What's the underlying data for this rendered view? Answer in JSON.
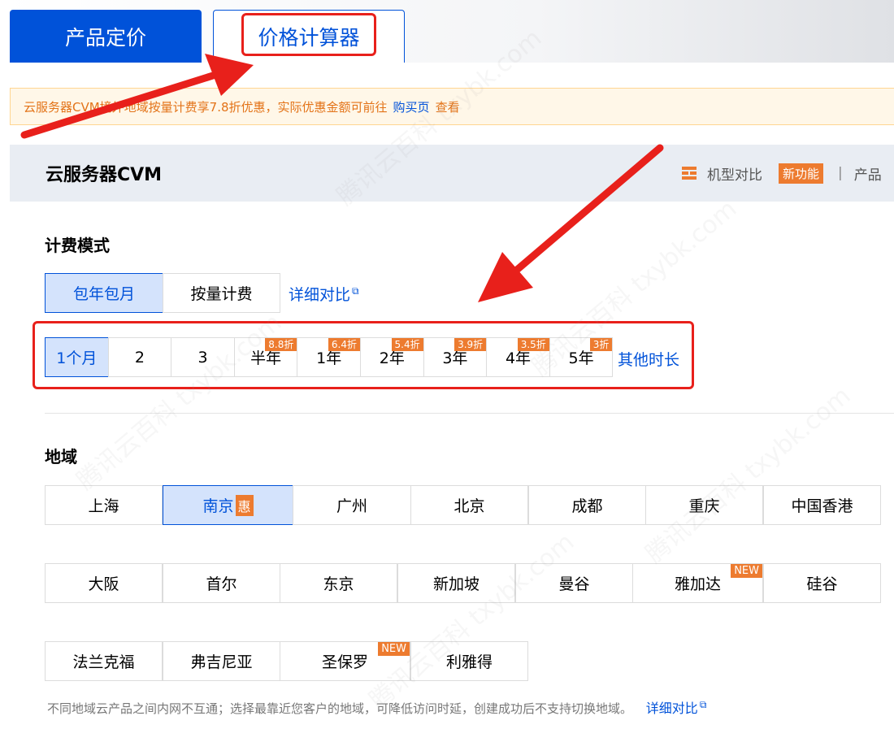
{
  "tabs": [
    {
      "label": "产品定价"
    },
    {
      "label": "价格计算器"
    }
  ],
  "notice": {
    "text": "云服务器CVM境外地域按量计费享7.8折优惠，实际优惠金额可前往",
    "link_label": "购买页",
    "suffix": "查看"
  },
  "header": {
    "title": "云服务器CVM",
    "compare_label": "机型对比",
    "new_badge": "新功能",
    "separator": "|",
    "truncated_label": "产品"
  },
  "billing": {
    "title": "计费模式",
    "options": [
      {
        "label": "包年包月",
        "selected": true
      },
      {
        "label": "按量计费",
        "selected": false
      }
    ],
    "detail_link": "详细对比"
  },
  "durations": {
    "options": [
      {
        "label": "1个月",
        "discount": "",
        "selected": true
      },
      {
        "label": "2",
        "discount": "",
        "selected": false
      },
      {
        "label": "3",
        "discount": "",
        "selected": false
      },
      {
        "label": "半年",
        "discount": "8.8折",
        "selected": false
      },
      {
        "label": "1年",
        "discount": "6.4折",
        "selected": false
      },
      {
        "label": "2年",
        "discount": "5.4折",
        "selected": false
      },
      {
        "label": "3年",
        "discount": "3.9折",
        "selected": false
      },
      {
        "label": "4年",
        "discount": "3.5折",
        "selected": false
      },
      {
        "label": "5年",
        "discount": "3折",
        "selected": false
      }
    ],
    "other_link": "其他时长"
  },
  "region": {
    "title": "地域",
    "rows": [
      [
        {
          "label": "上海",
          "tag": "",
          "selected": false
        },
        {
          "label": "南京",
          "tag": "惠",
          "selected": true
        },
        {
          "label": "广州",
          "tag": "",
          "selected": false
        },
        {
          "label": "北京",
          "tag": "",
          "selected": false
        },
        {
          "label": "成都",
          "tag": "",
          "selected": false
        },
        {
          "label": "重庆",
          "tag": "",
          "selected": false
        },
        {
          "label": "中国香港",
          "tag": "",
          "selected": false
        }
      ],
      [
        {
          "label": "大阪",
          "tag": "",
          "selected": false
        },
        {
          "label": "首尔",
          "tag": "",
          "selected": false
        },
        {
          "label": "东京",
          "tag": "",
          "selected": false
        },
        {
          "label": "新加坡",
          "tag": "",
          "selected": false
        },
        {
          "label": "曼谷",
          "tag": "",
          "selected": false
        },
        {
          "label": "雅加达",
          "tag": "NEW",
          "selected": false
        },
        {
          "label": "硅谷",
          "tag": "",
          "selected": false
        }
      ],
      [
        {
          "label": "法兰克福",
          "tag": "",
          "selected": false
        },
        {
          "label": "弗吉尼亚",
          "tag": "",
          "selected": false
        },
        {
          "label": "圣保罗",
          "tag": "NEW",
          "selected": false
        },
        {
          "label": "利雅得",
          "tag": "",
          "selected": false
        }
      ]
    ],
    "footnote": "不同地域云产品之间内网不互通；选择最靠近您客户的地域，可降低访问时延，创建成功后不支持切换地域。",
    "detail_link": "详细对比"
  },
  "watermark": "腾讯云百科 txybk.com",
  "colors": {
    "accent": "#0052d9",
    "discount": "#ed7b2f",
    "annotation": "#e8201b",
    "notice_bg": "#fff7e8"
  }
}
